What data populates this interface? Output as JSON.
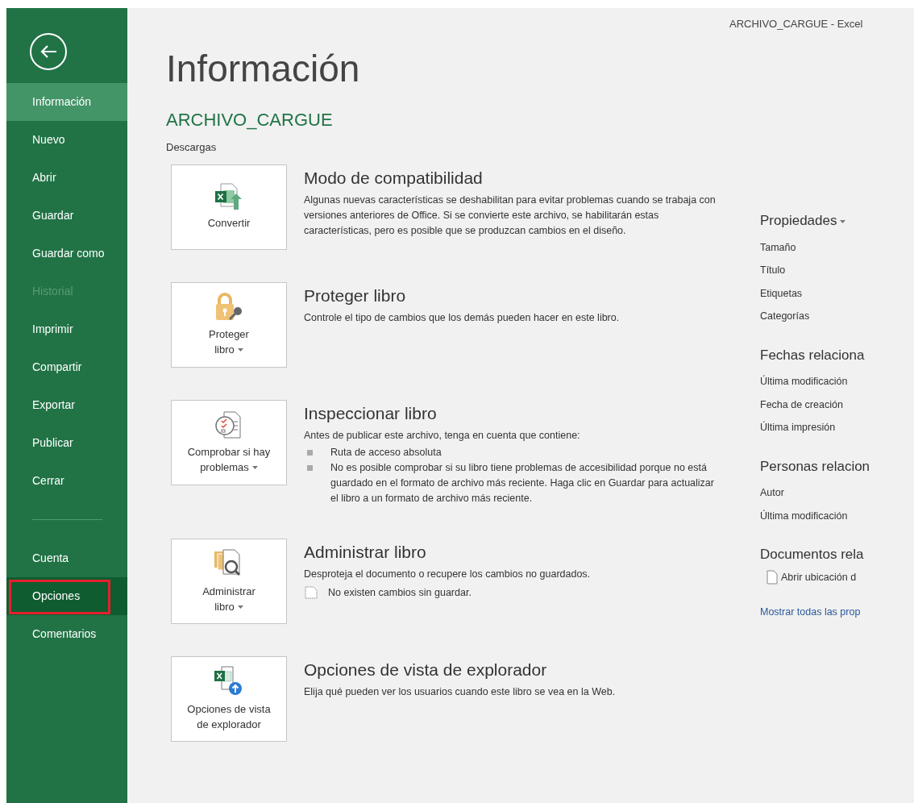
{
  "window": {
    "title": "ARCHIVO_CARGUE - Excel"
  },
  "sidebar": {
    "groups": [
      [
        {
          "label": "Información",
          "selected": true,
          "disabled": false,
          "hovered": false,
          "outlined": false
        },
        {
          "label": "Nuevo",
          "selected": false,
          "disabled": false,
          "hovered": false,
          "outlined": false
        },
        {
          "label": "Abrir",
          "selected": false,
          "disabled": false,
          "hovered": false,
          "outlined": false
        },
        {
          "label": "Guardar",
          "selected": false,
          "disabled": false,
          "hovered": false,
          "outlined": false
        },
        {
          "label": "Guardar como",
          "selected": false,
          "disabled": false,
          "hovered": false,
          "outlined": false
        },
        {
          "label": "Historial",
          "selected": false,
          "disabled": true,
          "hovered": false,
          "outlined": false
        },
        {
          "label": "Imprimir",
          "selected": false,
          "disabled": false,
          "hovered": false,
          "outlined": false
        },
        {
          "label": "Compartir",
          "selected": false,
          "disabled": false,
          "hovered": false,
          "outlined": false
        },
        {
          "label": "Exportar",
          "selected": false,
          "disabled": false,
          "hovered": false,
          "outlined": false
        },
        {
          "label": "Publicar",
          "selected": false,
          "disabled": false,
          "hovered": false,
          "outlined": false
        },
        {
          "label": "Cerrar",
          "selected": false,
          "disabled": false,
          "hovered": false,
          "outlined": false
        }
      ],
      [
        {
          "label": "Cuenta",
          "selected": false,
          "disabled": false,
          "hovered": false,
          "outlined": false
        },
        {
          "label": "Opciones",
          "selected": false,
          "disabled": false,
          "hovered": true,
          "outlined": true
        },
        {
          "label": "Comentarios",
          "selected": false,
          "disabled": false,
          "hovered": false,
          "outlined": false
        }
      ]
    ]
  },
  "page": {
    "heading": "Información",
    "file_name": "ARCHIVO_CARGUE",
    "location": "Descargas"
  },
  "sections": [
    {
      "kind": "convert",
      "button_lines": [
        "Convertir"
      ],
      "dropdown": false,
      "title": "Modo de compatibilidad",
      "description": "Algunas nuevas características se deshabilitan para evitar problemas cuando se trabaja con versiones anteriores de Office. Si se convierte este archivo, se habilitarán estas características, pero es posible que se produzcan cambios en el diseño."
    },
    {
      "kind": "protect",
      "button_lines": [
        "Proteger",
        "libro"
      ],
      "dropdown": true,
      "title": "Proteger libro",
      "description": "Controle el tipo de cambios que los demás pueden hacer en este libro."
    },
    {
      "kind": "inspect",
      "button_lines": [
        "Comprobar si hay",
        "problemas"
      ],
      "dropdown": true,
      "title": "Inspeccionar libro",
      "description": "Antes de publicar este archivo, tenga en cuenta que contiene:",
      "bullets": [
        "Ruta de acceso absoluta",
        "No es posible comprobar si su libro tiene problemas de accesibilidad porque no está guardado en el formato de archivo más reciente. Haga clic en Guardar para actualizar el libro a un formato de archivo más reciente."
      ]
    },
    {
      "kind": "manage",
      "button_lines": [
        "Administrar",
        "libro"
      ],
      "dropdown": true,
      "title": "Administrar libro",
      "description": "Desproteja el documento o recupere los cambios no guardados.",
      "note": "No existen cambios sin guardar."
    },
    {
      "kind": "browser",
      "button_lines": [
        "Opciones de vista",
        "de explorador"
      ],
      "dropdown": false,
      "title": "Opciones de vista de explorador",
      "description": "Elija qué pueden ver los usuarios cuando este libro se vea en la Web."
    }
  ],
  "properties": {
    "groups": [
      {
        "heading": "Propiedades",
        "dropdown": true,
        "rows": [
          "Tamaño",
          "Título",
          "Etiquetas",
          "Categorías"
        ]
      },
      {
        "heading": "Fechas relaciona",
        "dropdown": false,
        "rows": [
          "Última modificación",
          "Fecha de creación",
          "Última impresión"
        ]
      },
      {
        "heading": "Personas relacion",
        "dropdown": false,
        "rows": [
          "Autor",
          "Última modificación"
        ]
      },
      {
        "heading": "Documentos rela",
        "dropdown": false,
        "file_links": [
          "Abrir ubicación d"
        ]
      }
    ],
    "link": "Mostrar todas las prop"
  }
}
